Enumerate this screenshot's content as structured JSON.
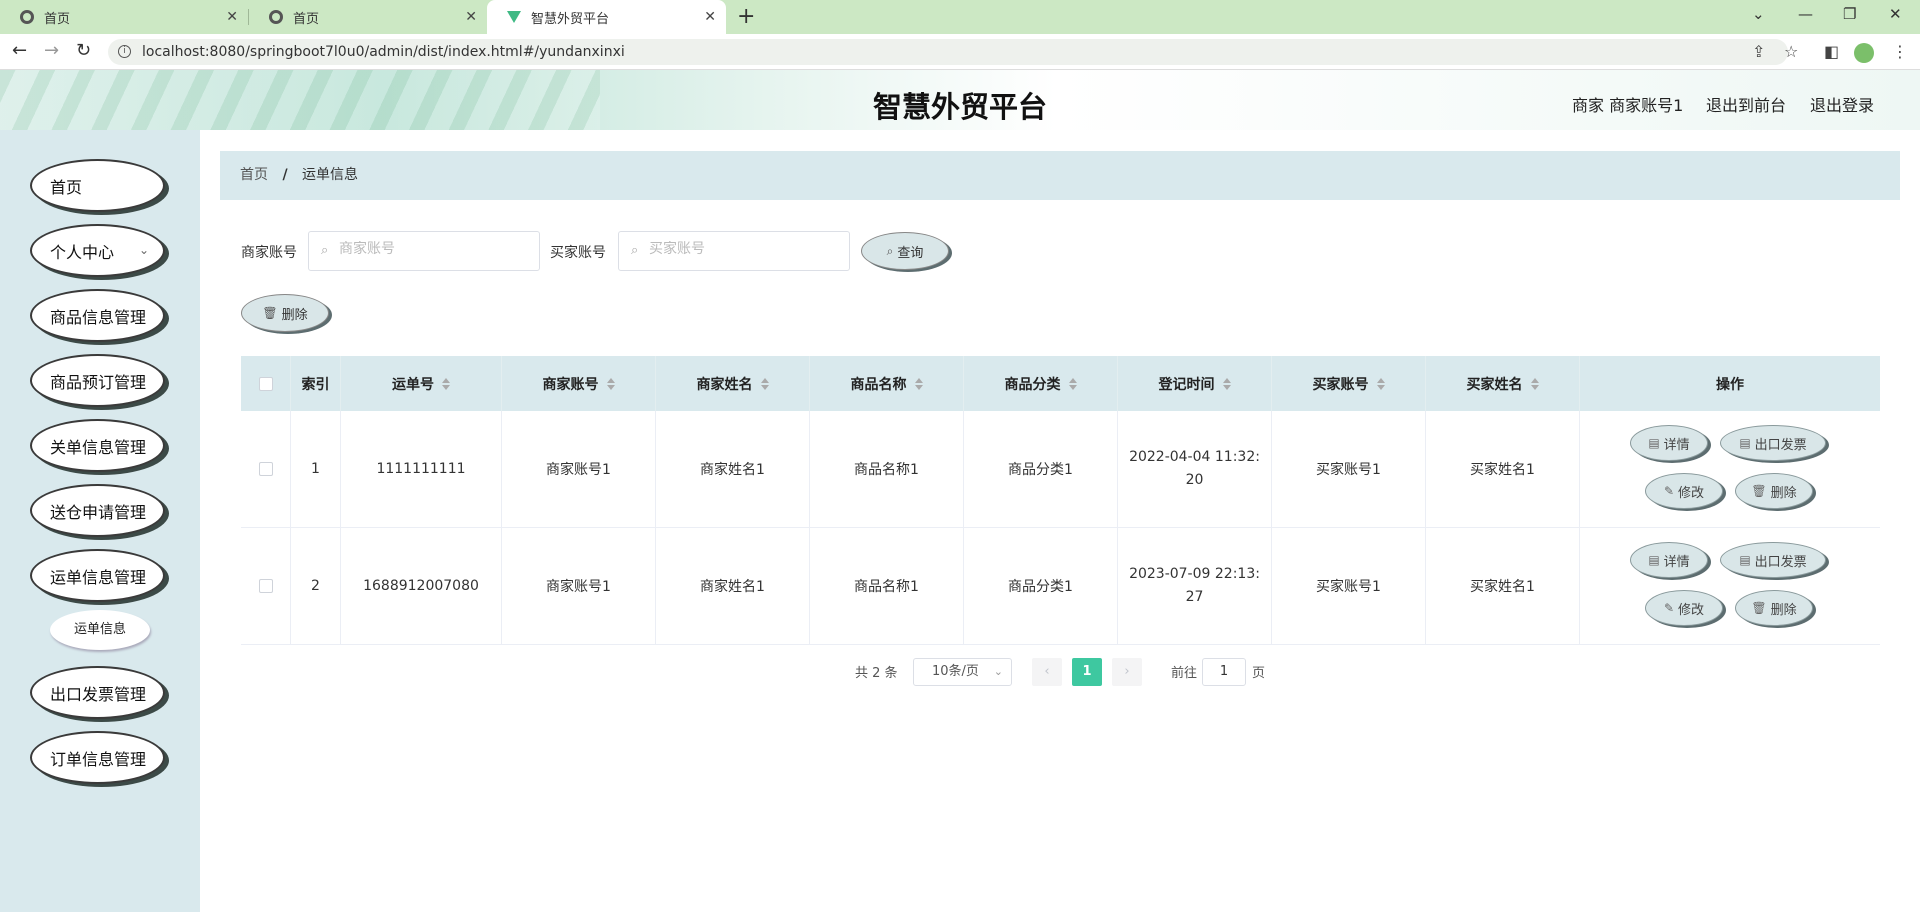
{
  "browser": {
    "tabs": [
      {
        "title": "首页",
        "icon": "globe-icon",
        "active": false
      },
      {
        "title": "首页",
        "icon": "globe-icon",
        "active": false
      },
      {
        "title": "智慧外贸平台",
        "icon": "vue-logo-icon",
        "active": true
      }
    ],
    "url": "localhost:8080/springboot7l0u0/admin/dist/index.html#/yundanxinxi"
  },
  "header": {
    "title": "智慧外贸平台",
    "user": "商家 商家账号1",
    "front_link": "退出到前台",
    "logout_link": "退出登录"
  },
  "sidebar": {
    "items": [
      {
        "label": "首页"
      },
      {
        "label": "个人中心",
        "has_chevron": true
      },
      {
        "label": "商品信息管理"
      },
      {
        "label": "商品预订管理"
      },
      {
        "label": "关单信息管理"
      },
      {
        "label": "送仓申请管理"
      },
      {
        "label": "运单信息管理"
      },
      {
        "label": "出口发票管理"
      },
      {
        "label": "订单信息管理"
      }
    ],
    "submenu": {
      "label": "运单信息"
    }
  },
  "breadcrumb": {
    "home": "首页",
    "separator": "/",
    "current": "运单信息"
  },
  "search": {
    "merchant_label": "商家账号",
    "merchant_placeholder": "商家账号",
    "buyer_label": "买家账号",
    "buyer_placeholder": "买家账号",
    "query_button": "查询",
    "delete_button": "删除"
  },
  "table": {
    "headers": [
      "索引",
      "运单号",
      "商家账号",
      "商家姓名",
      "商品名称",
      "商品分类",
      "登记时间",
      "买家账号",
      "买家姓名",
      "操作"
    ],
    "rows": [
      {
        "index": "1",
        "waybill": "1111111111",
        "merchant_account": "商家账号1",
        "merchant_name": "商家姓名1",
        "product_name": "商品名称1",
        "category": "商品分类1",
        "time": "2022-04-04 11:32:20",
        "buyer_account": "买家账号1",
        "buyer_name": "买家姓名1"
      },
      {
        "index": "2",
        "waybill": "1688912007080",
        "merchant_account": "商家账号1",
        "merchant_name": "商家姓名1",
        "product_name": "商品名称1",
        "category": "商品分类1",
        "time": "2023-07-09 22:13:27",
        "buyer_account": "买家账号1",
        "buyer_name": "买家姓名1"
      }
    ],
    "actions": {
      "detail": "详情",
      "invoice": "出口发票",
      "edit": "修改",
      "delete": "删除"
    }
  },
  "pagination": {
    "total": "共 2 条",
    "page_size": "10条/页",
    "current_page": "1",
    "goto_prefix": "前往",
    "goto_value": "1",
    "goto_suffix": "页"
  }
}
